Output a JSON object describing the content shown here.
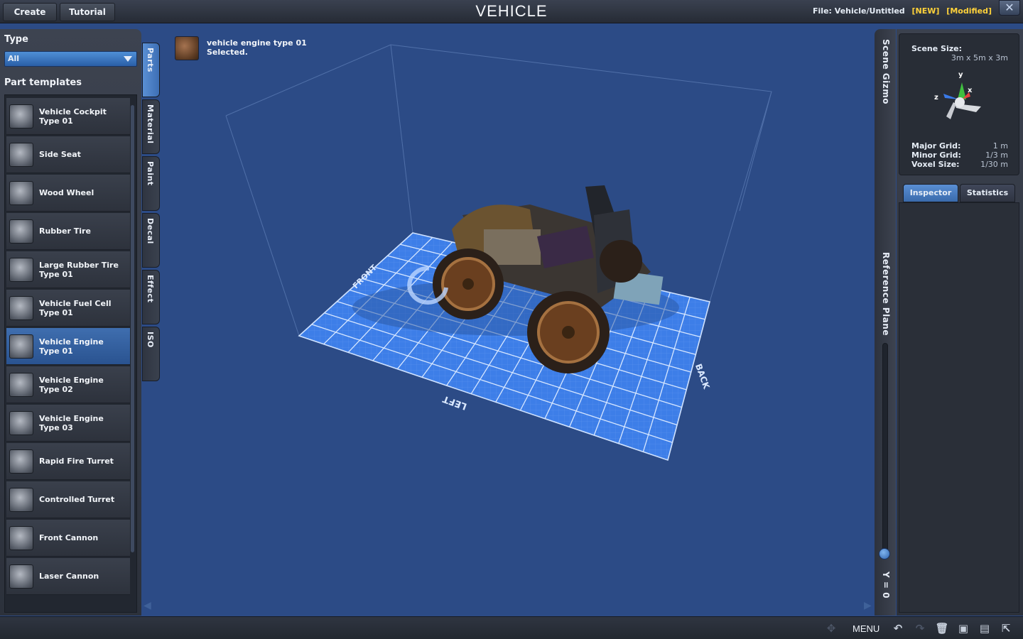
{
  "topbar": {
    "create_label": "Create",
    "tutorial_label": "Tutorial",
    "title": "VEHICLE",
    "file_prefix": "File:",
    "file_path": "Vehicle/Untitled",
    "flag_new": "[NEW]",
    "flag_modified": "[Modified]",
    "close_icon": "close-icon"
  },
  "left_panel": {
    "type_label": "Type",
    "type_value": "All",
    "templates_label": "Part templates",
    "parts": [
      {
        "name": "Vehicle Cockpit\nType 01",
        "icon": "cockpit-icon"
      },
      {
        "name": "Side Seat",
        "icon": "seat-icon"
      },
      {
        "name": "Wood Wheel",
        "icon": "wheel-icon"
      },
      {
        "name": "Rubber Tire",
        "icon": "tire-icon"
      },
      {
        "name": "Large Rubber Tire\nType 01",
        "icon": "tire-icon"
      },
      {
        "name": "Vehicle Fuel Cell\nType 01",
        "icon": "fuel-cell-icon"
      },
      {
        "name": "Vehicle Engine\nType 01",
        "icon": "engine-icon",
        "selected": true
      },
      {
        "name": "Vehicle Engine\nType 02",
        "icon": "engine-icon"
      },
      {
        "name": "Vehicle Engine\nType 03",
        "icon": "engine-icon"
      },
      {
        "name": "Rapid Fire Turret",
        "icon": "turret-icon"
      },
      {
        "name": "Controlled Turret",
        "icon": "turret-icon"
      },
      {
        "name": "Front Cannon",
        "icon": "cannon-icon"
      },
      {
        "name": "Laser Cannon",
        "icon": "cannon-icon"
      }
    ]
  },
  "side_tabs": [
    "Parts",
    "Material",
    "Paint",
    "Decal",
    "Effect",
    "ISO"
  ],
  "viewport": {
    "selected_name": "vehicle engine type 01",
    "selected_status": "Selected.",
    "grid_labels": {
      "front": "FRONT",
      "left": "LEFT",
      "back": "BACK"
    }
  },
  "right_strip": {
    "gizmo_label": "Scene Gizmo",
    "ref_plane_label": "Reference Plane",
    "y_value": "Y = 0"
  },
  "right_panel": {
    "scene_size_label": "Scene Size:",
    "scene_size_value": "3m x 5m x 3m",
    "axis_y": "y",
    "axis_x": "x",
    "axis_z": "z",
    "major_grid_label": "Major Grid:",
    "major_grid_value": "1 m",
    "minor_grid_label": "Minor Grid:",
    "minor_grid_value": "1/3 m",
    "voxel_size_label": "Voxel Size:",
    "voxel_size_value": "1/30 m",
    "tab_inspector": "Inspector",
    "tab_statistics": "Statistics",
    "colors": {
      "x_axis": "#e84040",
      "y_axis": "#40c040",
      "z_axis": "#3a7ae8"
    }
  },
  "bottombar": {
    "menu_label": "MENU",
    "icons": [
      "move-icon",
      "undo-icon",
      "redo-icon",
      "delete-icon",
      "save-icon",
      "save-as-icon",
      "export-icon"
    ]
  }
}
